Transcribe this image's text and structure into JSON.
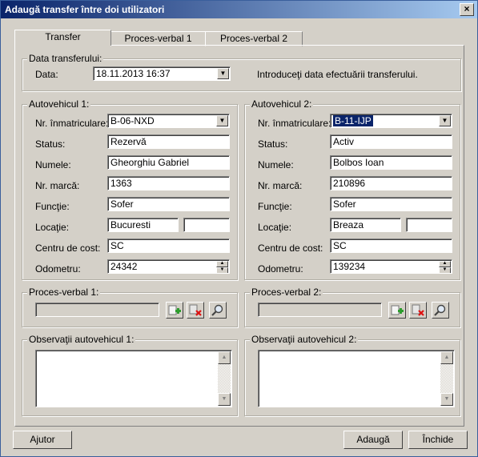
{
  "window": {
    "title": "Adaugă transfer între doi utilizatori",
    "close_glyph": "×"
  },
  "tabs": [
    {
      "label": "Transfer"
    },
    {
      "label": "Proces-verbal 1"
    },
    {
      "label": "Proces-verbal 2"
    }
  ],
  "date_group": {
    "legend": "Data transferului:",
    "label": "Data:",
    "value": "18.11.2013 16:37",
    "hint": "Introduceţi data efectuării transferului."
  },
  "vehicle1": {
    "legend": "Autovehicul 1:",
    "labels": {
      "plate": "Nr. înmatriculare:",
      "status": "Status:",
      "name": "Numele:",
      "mark": "Nr. marcă:",
      "function": "Funcţie:",
      "location": "Locaţie:",
      "cost_center": "Centru de cost:",
      "odometer": "Odometru:"
    },
    "plate": "B-06-NXD",
    "status": "Rezervă",
    "name": "Gheorghiu Gabriel",
    "mark": "1363",
    "function": "Sofer",
    "location": "Bucuresti",
    "location2": "",
    "cost_center": "SC",
    "odometer": "24342"
  },
  "vehicle2": {
    "legend": "Autovehicul 2:",
    "labels": {
      "plate": "Nr. înmatriculare:",
      "status": "Status:",
      "name": "Numele:",
      "mark": "Nr. marcă:",
      "function": "Funcţie:",
      "location": "Locaţie:",
      "cost_center": "Centru de cost:",
      "odometer": "Odometru:"
    },
    "plate": "B-11-IJP",
    "status": "Activ",
    "name": "Bolbos Ioan",
    "mark": "210896",
    "function": "Sofer",
    "location": "Breaza",
    "location2": "",
    "cost_center": "SC",
    "odometer": "139234"
  },
  "pv1": {
    "legend": "Proces-verbal 1:"
  },
  "pv2": {
    "legend": "Proces-verbal 2:"
  },
  "obs1": {
    "legend": "Observaţii autovehicul 1:",
    "value": ""
  },
  "obs2": {
    "legend": "Observaţii autovehicul 2:",
    "value": ""
  },
  "icons": {
    "add": "add-document-icon",
    "delete": "delete-document-icon",
    "view": "magnifier-icon"
  },
  "colors": {
    "title_start": "#0a246a",
    "title_end": "#a6caf0",
    "face": "#d4d0c8",
    "selection": "#0a246a"
  },
  "buttons": {
    "help": "Ajutor",
    "add": "Adaugă",
    "close": "Închide"
  }
}
